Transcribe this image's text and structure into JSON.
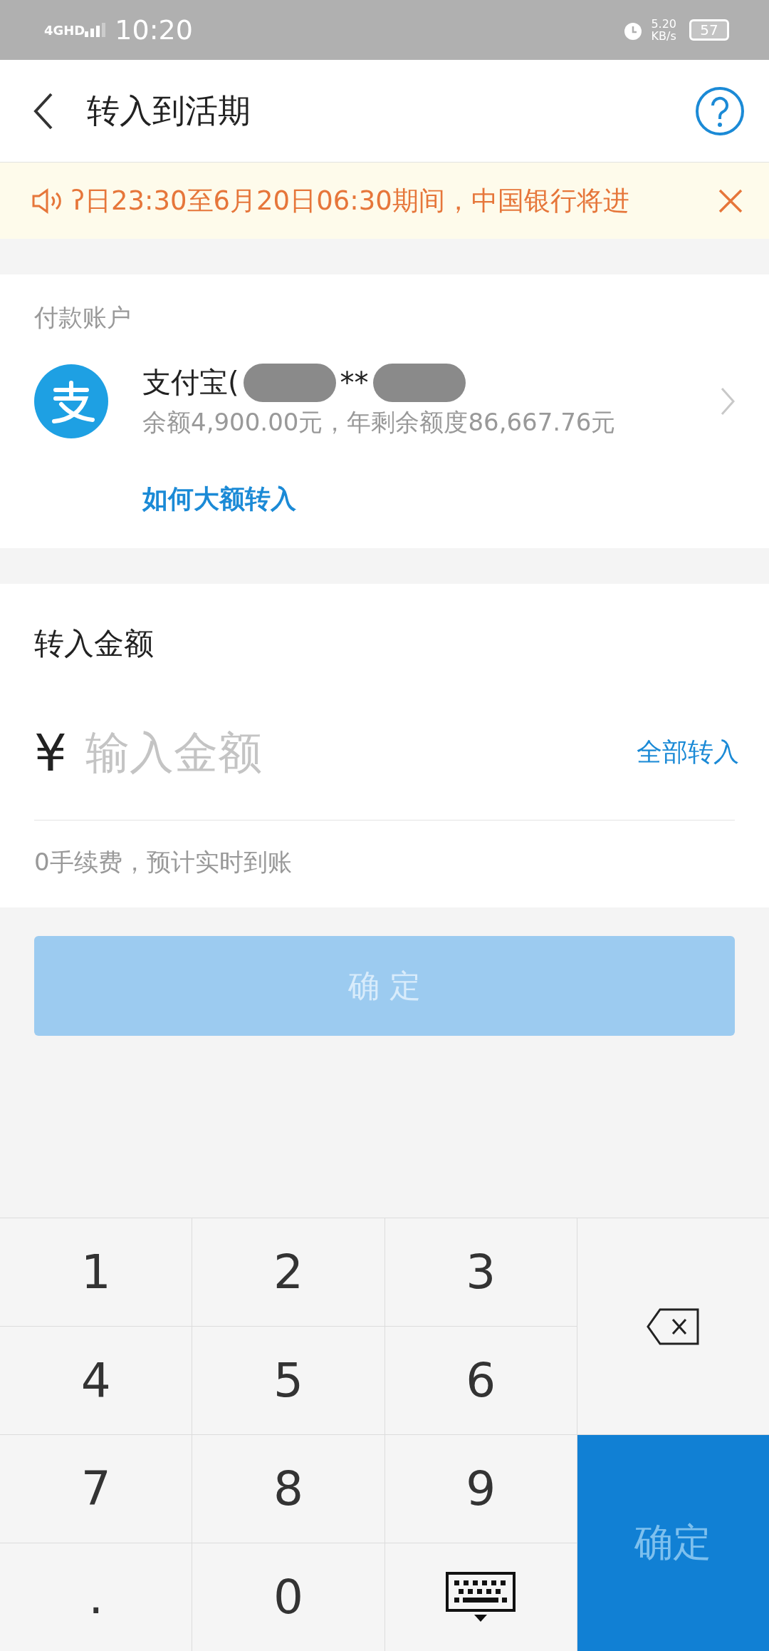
{
  "status_bar": {
    "network": "4GHD",
    "time": "10:20",
    "speed": "5.20",
    "speed_unit": "KB/s",
    "battery": "57"
  },
  "header": {
    "title": "转入到活期"
  },
  "notice": {
    "text": "ʔ日23:30至6月20日06:30期间，中国银行将进"
  },
  "payment": {
    "label": "付款账户",
    "account_name": "支付宝(",
    "account_masked": "**",
    "balance": "余额4,900.00元，年剩余额度86,667.76元",
    "link": "如何大额转入"
  },
  "amount": {
    "label": "转入金额",
    "currency": "¥",
    "placeholder": "输入金额",
    "all_button": "全部转入",
    "fee_note": "0手续费，预计实时到账"
  },
  "confirm_button": {
    "label": "确 定",
    "disabled": true
  },
  "keypad": {
    "keys": [
      {
        "kind": "digit",
        "label": "1"
      },
      {
        "kind": "digit",
        "label": "2"
      },
      {
        "kind": "digit",
        "label": "3"
      },
      {
        "kind": "delete"
      },
      {
        "kind": "digit",
        "label": "4"
      },
      {
        "kind": "digit",
        "label": "5"
      },
      {
        "kind": "digit",
        "label": "6"
      },
      {
        "kind": "digit",
        "label": "7"
      },
      {
        "kind": "digit",
        "label": "8"
      },
      {
        "kind": "digit",
        "label": "9"
      },
      {
        "kind": "confirm",
        "label": "确定"
      },
      {
        "kind": "digit",
        "label": "."
      },
      {
        "kind": "digit",
        "label": "0"
      },
      {
        "kind": "hide"
      }
    ]
  }
}
